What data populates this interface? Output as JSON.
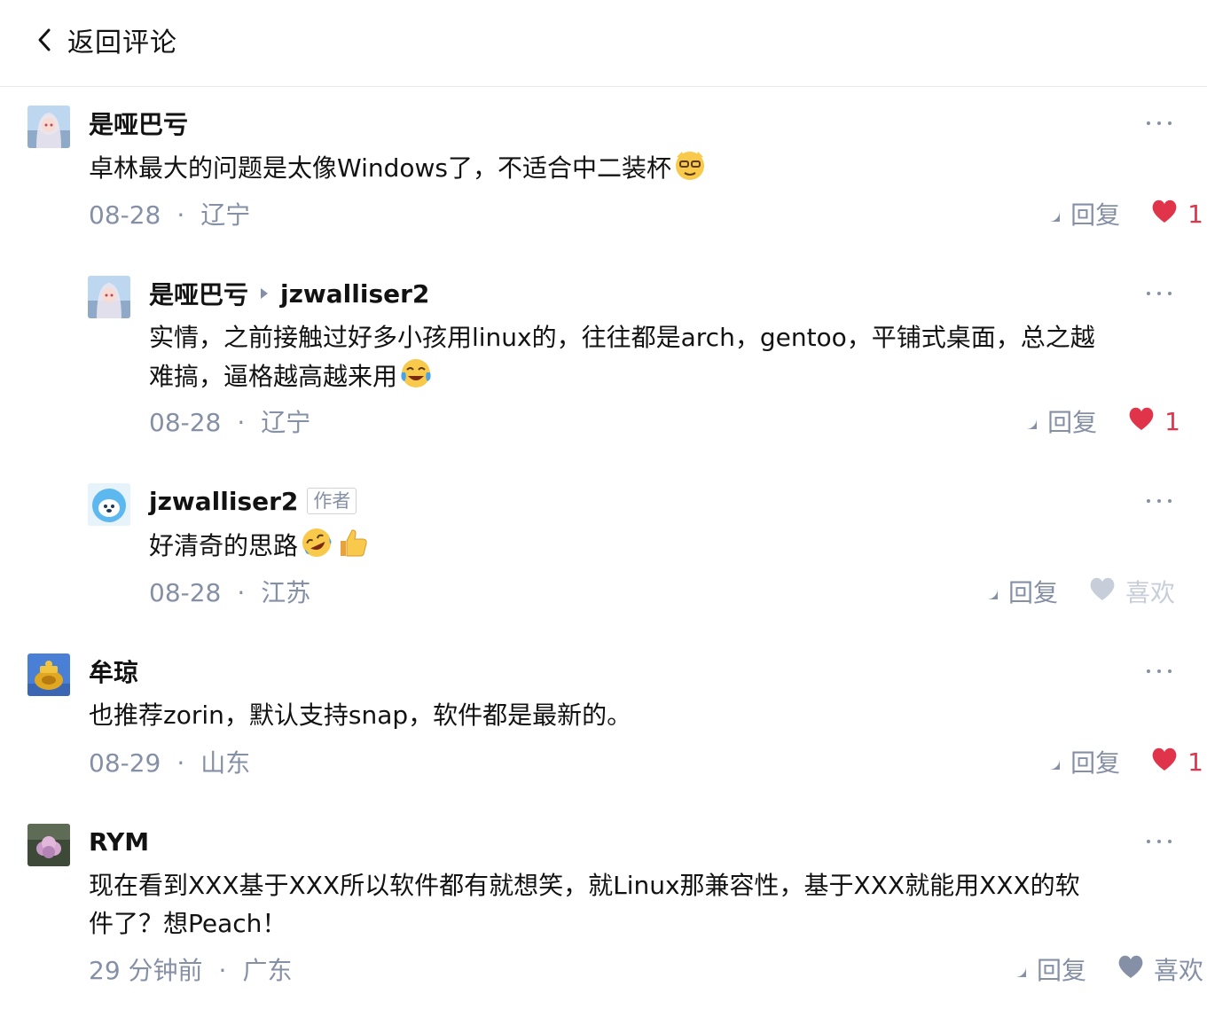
{
  "header": {
    "back_label": "返回评论"
  },
  "comments": [
    {
      "author": "是哑巴亏",
      "content": "卓林最大的问题是太像Windows了，不适合中二装杯",
      "date": "08-28",
      "location": "辽宁",
      "reply_label": "回复",
      "like_count": "1",
      "liked": true
    },
    {
      "author": "是哑巴亏",
      "reply_to": "jzwalliser2",
      "content_line1": "实情，之前接触过好多小孩用linux的，往往都是arch，gentoo，平铺式桌面，总之越",
      "content_line2": "难搞，逼格越高越来用",
      "date": "08-28",
      "location": "辽宁",
      "reply_label": "回复",
      "like_count": "1",
      "liked": true
    },
    {
      "author": "jzwalliser2",
      "badge": "作者",
      "content": "好清奇的思路",
      "date": "08-28",
      "location": "江苏",
      "reply_label": "回复",
      "like_label": "喜欢",
      "liked": false
    },
    {
      "author": "牟琼",
      "content": "也推荐zorin，默认支持snap，软件都是最新的。",
      "date": "08-29",
      "location": "山东",
      "reply_label": "回复",
      "like_count": "1",
      "liked": true
    },
    {
      "author": "RYM",
      "content_line1": "现在看到XXX基于XXX所以软件都有就想笑，就Linux那兼容性，基于XXX就能用XXX的软",
      "content_line2": "件了？想Peach！",
      "date": "29 分钟前",
      "location": "广东",
      "reply_label": "回复",
      "like_label": "喜欢",
      "liked": false
    }
  ],
  "separator": "·",
  "colors": {
    "text": "#121212",
    "meta": "#8590a6",
    "like_active": "#e0344b",
    "like_inactive_light": "#c7ced9"
  }
}
